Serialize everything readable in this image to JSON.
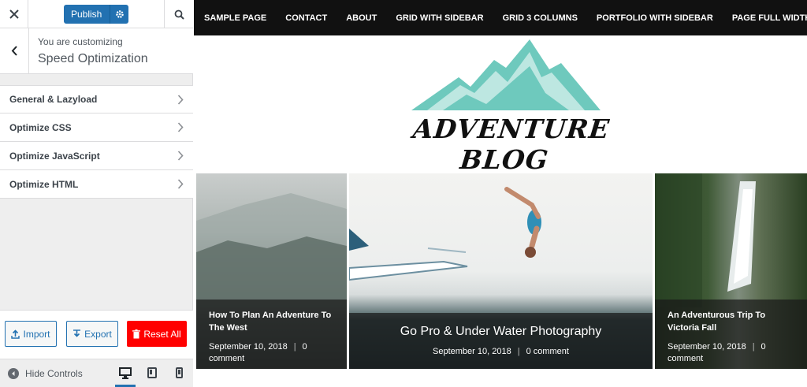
{
  "topbar": {
    "close_icon": "close-icon",
    "publish_label": "Publish",
    "settings_icon": "gear-icon",
    "search_icon": "search-icon"
  },
  "customizing": {
    "label": "You are customizing",
    "title": "Speed Optimization"
  },
  "sections": [
    {
      "label": "General & Lazyload"
    },
    {
      "label": "Optimize CSS"
    },
    {
      "label": "Optimize JavaScript"
    },
    {
      "label": "Optimize HTML"
    }
  ],
  "actions": {
    "import_label": "Import",
    "export_label": "Export",
    "reset_label": "Reset All"
  },
  "footer": {
    "hide_controls_label": "Hide Controls",
    "devices": [
      "desktop",
      "tablet",
      "mobile"
    ],
    "active_device": "desktop"
  },
  "preview": {
    "nav": [
      "SAMPLE PAGE",
      "CONTACT",
      "ABOUT",
      "GRID WITH SIDEBAR",
      "GRID 3 COLUMNS",
      "PORTFOLIO WITH SIDEBAR",
      "PAGE FULL WIDTH"
    ],
    "logo_text": "ADVENTURE BLOG",
    "posts": [
      {
        "title": "How To Plan An Adventure To The West",
        "date": "September 10, 2018",
        "comments": "0 comment"
      },
      {
        "title": "Go Pro & Under Water Photography",
        "date": "September 10, 2018",
        "comments": "0 comment"
      },
      {
        "title": "An Adventurous Trip To Victoria Fall",
        "date": "September 10, 2018",
        "comments": "0 comment"
      }
    ]
  },
  "colors": {
    "accent": "#2271b1",
    "reset": "#ff0000",
    "nav_bg": "#111111",
    "logo_teal": "#6ec9bd"
  }
}
